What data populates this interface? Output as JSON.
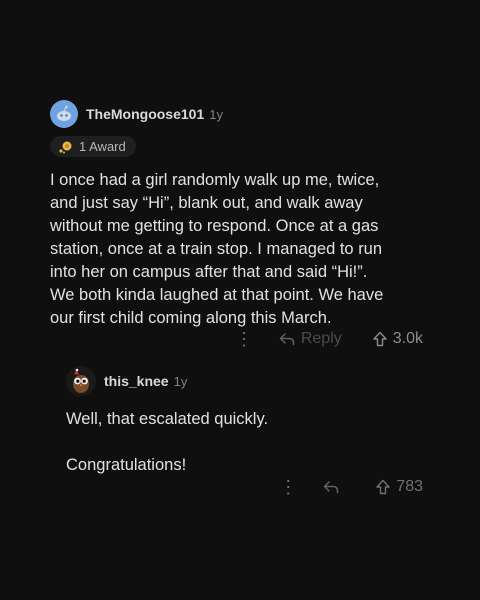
{
  "comment1": {
    "username": "TheMongoose101",
    "age": "1y",
    "award": "1 Award",
    "body": "I once had a girl randomly walk up me, twice,\nand just say “Hi”, blank out, and walk away\nwithout me getting to respond. Once at a gas\nstation, once at a train stop. I managed to run\ninto her on campus after that and said  “Hi!”.\nWe both kinda laughed at that point. We have\nour first child coming along this March.",
    "menu": "⋮",
    "reply_label": "Reply",
    "votes": "3.0k"
  },
  "comment2": {
    "username": "this_knee",
    "age": "1y",
    "body": "Well, that escalated quickly.\n\nCongratulations!",
    "menu": "⋮",
    "votes": "783"
  },
  "colors": {
    "background": "#0f0f0f",
    "text": "#d7dadc",
    "muted": "#6f7173",
    "avatar_blue": "#6ea2e0"
  },
  "icons": [
    "reddit-avatar-icon",
    "award-icon",
    "owl-avatar-icon",
    "more-options-icon",
    "reply-arrow-icon",
    "upvote-arrow-icon"
  ]
}
